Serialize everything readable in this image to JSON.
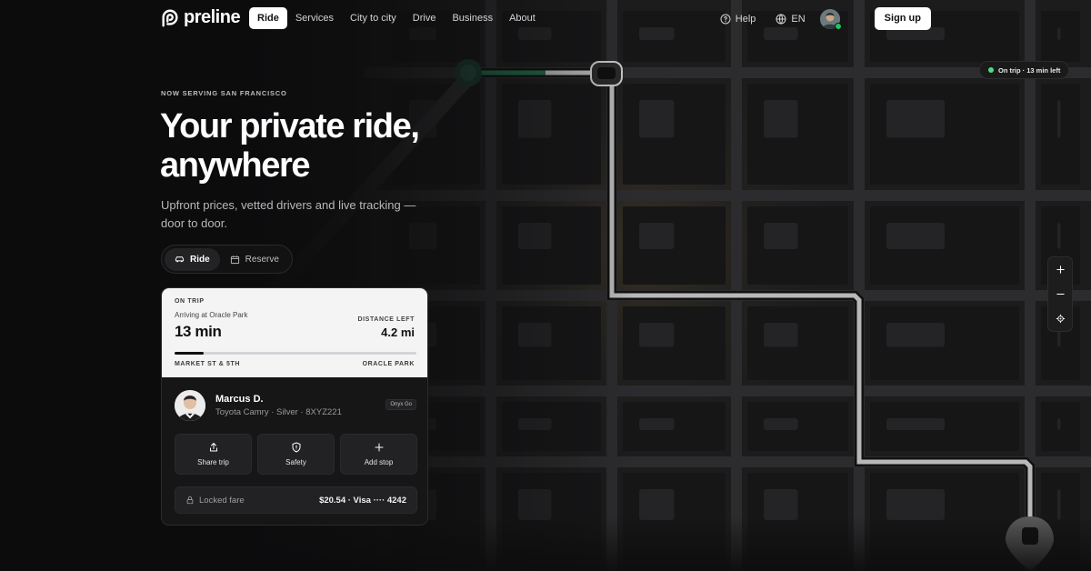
{
  "brand": {
    "name": "preline"
  },
  "nav": {
    "items": [
      {
        "label": "Ride",
        "active": true
      },
      {
        "label": "Services"
      },
      {
        "label": "City to city"
      },
      {
        "label": "Drive"
      },
      {
        "label": "Business"
      },
      {
        "label": "About"
      }
    ],
    "help": "Help",
    "language": "EN",
    "signup": "Sign up"
  },
  "hero": {
    "eyebrow": "NOW SERVING SAN FRANCISCO",
    "title": "Your private ride, anywhere",
    "subtitle": "Upfront prices, vetted drivers and live tracking — door to door.",
    "toggle": {
      "ride": "Ride",
      "reserve": "Reserve",
      "selected": "Ride"
    }
  },
  "trip": {
    "status_label": "ON TRIP",
    "arriving": "Arriving at Oracle Park",
    "eta": "13 min",
    "distance_label": "DISTANCE LEFT",
    "distance": "4.2 mi",
    "progress": 0.12,
    "from": "MARKET ST & 5TH",
    "to": "ORACLE PARK",
    "driver": {
      "name": "Marcus D.",
      "car": "Toyota Camry · Silver · 8XYZ221",
      "tier": "Onyx Go"
    },
    "actions": [
      {
        "label": "Share trip",
        "icon": "share-icon"
      },
      {
        "label": "Safety",
        "icon": "shield-icon"
      },
      {
        "label": "Add stop",
        "icon": "plus-icon"
      }
    ],
    "fare_label": "Locked fare",
    "fare_value": "$20.54 · Visa ···· 4242"
  },
  "map": {
    "status_pill": "On trip · 13 min left",
    "controls": [
      "zoom-in-icon",
      "zoom-out-icon",
      "locate-icon"
    ],
    "colors": {
      "route": "#b8b8b8",
      "route_start": "#1f6b4a",
      "pin": "#5a5a5a"
    }
  }
}
